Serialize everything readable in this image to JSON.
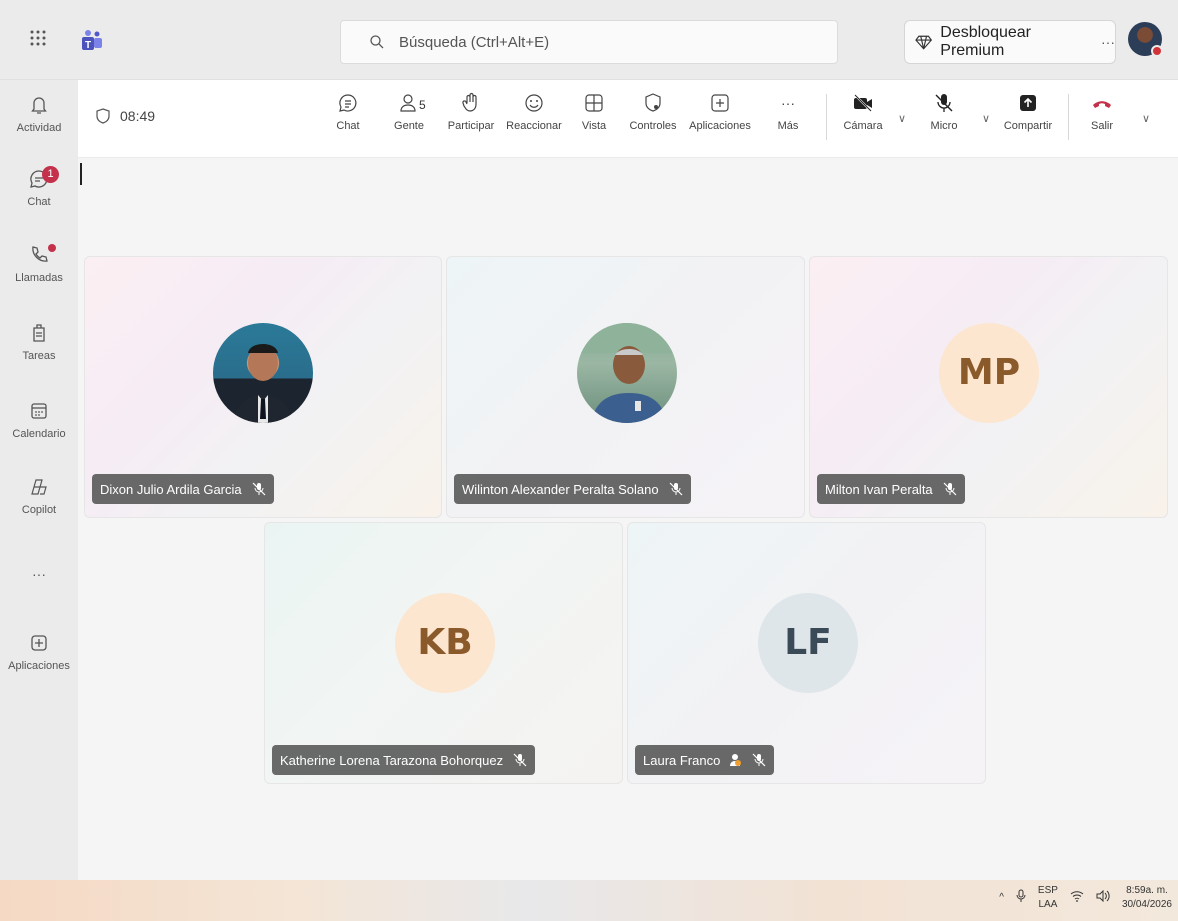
{
  "search": {
    "placeholder": "Búsqueda (Ctrl+Alt+E)"
  },
  "premium": {
    "label": "Desbloquear Premium",
    "more": "···"
  },
  "rail": {
    "items": [
      {
        "label": "Actividad",
        "icon": "bell-icon"
      },
      {
        "label": "Chat",
        "icon": "chat-icon",
        "badge": "1"
      },
      {
        "label": "Llamadas",
        "icon": "phone-icon"
      },
      {
        "label": "Tareas",
        "icon": "tasks-icon"
      },
      {
        "label": "Calendario",
        "icon": "calendar-icon"
      },
      {
        "label": "Copilot",
        "icon": "copilot-icon"
      },
      {
        "label": "···",
        "icon": "more-icon"
      },
      {
        "label": "Aplicaciones",
        "icon": "add-apps-icon"
      }
    ]
  },
  "meeting": {
    "time": "08:49",
    "people_count": "5",
    "toolbar": {
      "chat": "Chat",
      "people": "Gente",
      "raise": "Participar",
      "react": "Reaccionar",
      "view": "Vista",
      "controls": "Controles",
      "apps": "Aplicaciones",
      "more": "Más",
      "more_glyph": "···",
      "camera": "Cámara",
      "mic": "Micro",
      "share": "Compartir",
      "leave": "Salir"
    }
  },
  "participants": [
    {
      "name": "Dixon Julio Ardila Garcia",
      "type": "photo"
    },
    {
      "name": "Wilinton Alexander Peralta Solano",
      "type": "photo"
    },
    {
      "name": "Milton Ivan Peralta",
      "type": "initials",
      "initials": "MP"
    },
    {
      "name": "Katherine Lorena Tarazona Bohorquez",
      "type": "initials",
      "initials": "KB"
    },
    {
      "name": "Laura Franco",
      "type": "initials",
      "initials": "LF"
    }
  ],
  "taskbar": {
    "lang_top": "ESP",
    "lang_bottom": "LAA",
    "time": "8:59a. m.",
    "date": "30/04/2026",
    "caret": "^"
  },
  "colors": {
    "accent": "#5b5fc7",
    "badge": "#c4314b",
    "leave": "#c4314b"
  }
}
